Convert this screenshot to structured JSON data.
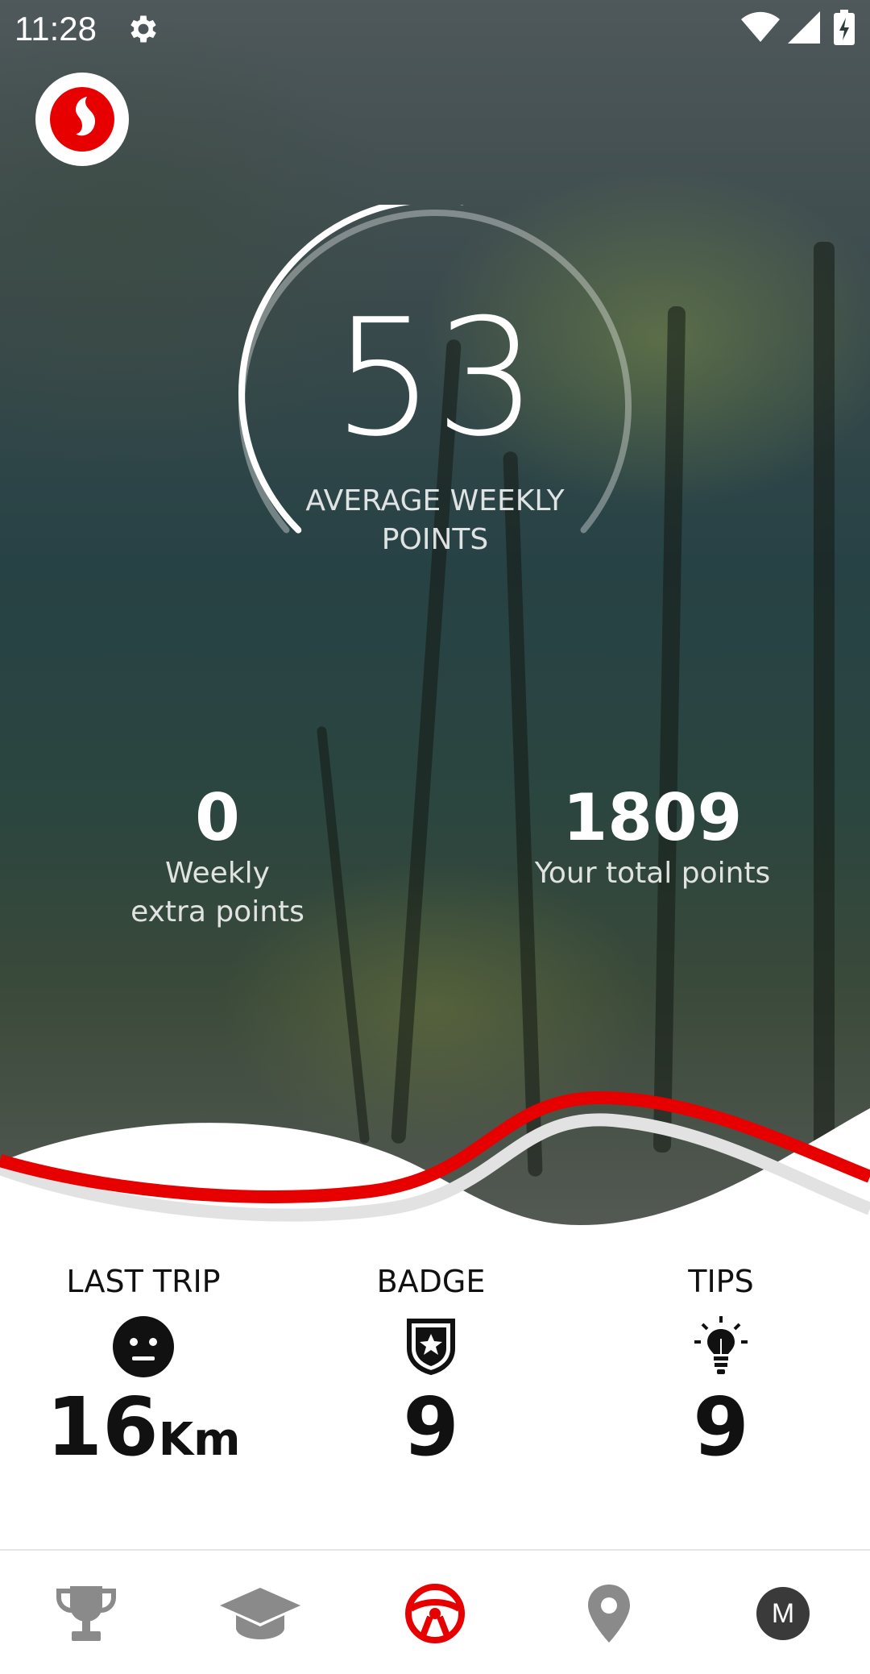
{
  "status_bar": {
    "time": "11:28"
  },
  "score": {
    "value": "53",
    "label": "AVERAGE WEEKLY POINTS",
    "progress": 0.53
  },
  "stats": [
    {
      "value": "0",
      "label": "Weekly extra points"
    },
    {
      "value": "1809",
      "label": "Your total points"
    }
  ],
  "cards": {
    "last_trip": {
      "title": "LAST TRIP",
      "value": "16",
      "unit": "Km",
      "icon": "neutral-face-icon"
    },
    "badge": {
      "title": "BADGE",
      "value": "9",
      "icon": "shield-star-icon"
    },
    "tips": {
      "title": "TIPS",
      "value": "9",
      "icon": "lightbulb-icon"
    }
  },
  "nav": {
    "items": [
      "trophy-icon",
      "graduation-cap-icon",
      "steering-wheel-icon",
      "location-pin-icon",
      "profile-avatar"
    ],
    "active": "steering-wheel-icon",
    "avatar_letter": "M"
  },
  "colors": {
    "brand_red": "#E60000",
    "inactive_icon": "#8a8a8a"
  }
}
